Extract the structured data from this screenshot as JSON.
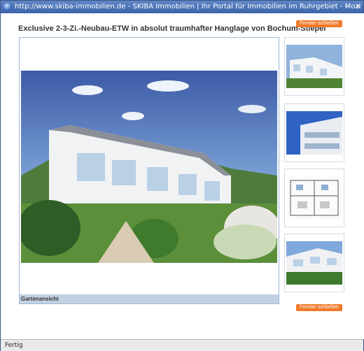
{
  "window": {
    "title": "http://www.skiba-immobilien.de - SKIBA Immobilien | Ihr Portal für Immobilien im Ruhrgebiet - Mozi",
    "minimize_glyph": "–",
    "close_glyph": "×"
  },
  "page": {
    "heading": "Exclusive 2-3-Zi.-Neubau-ETW in absolut traumhafter Hanglage von Bochum-Stiepel",
    "close_top_label": "Fenster schließen",
    "close_bottom_label": "Fenster schließen",
    "main_image": {
      "caption": "Gartenansicht"
    },
    "thumbnails": [
      {
        "name": "thumb-garden-view"
      },
      {
        "name": "thumb-balcony-view"
      },
      {
        "name": "thumb-floor-plan"
      },
      {
        "name": "thumb-front-view"
      }
    ]
  },
  "status": {
    "text": "Fertig"
  },
  "colors": {
    "accent": "#f07a2a",
    "titlebar": "#3c64a8",
    "frame": "#9fb7d3"
  }
}
